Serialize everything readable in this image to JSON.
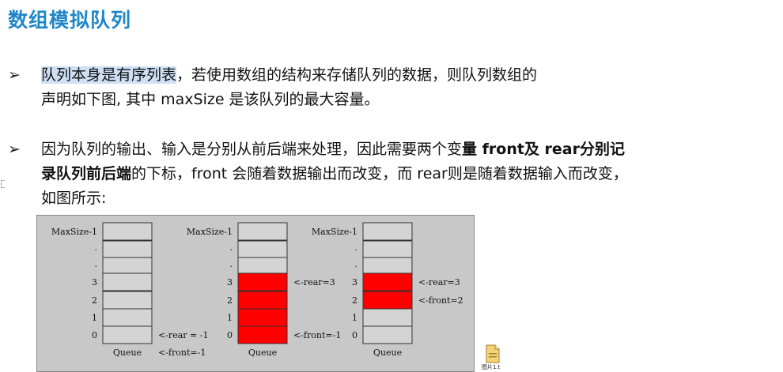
{
  "title": "数组模拟队列",
  "bullet_symbol": "➢",
  "bullets": [
    {
      "highlight": "队列本身是有序列表",
      "text_a": "，若使用数组的结构来存储队列的数据，则队列数组的",
      "text_b": "声明如下图, 其中 maxSize 是该队列的最大容量。"
    },
    {
      "text_a": "因为队列的输出、输入是分别从前后端来处理，因此需要两个变",
      "bold_a": "量 front及 rear分别记",
      "bold_b": "录队列前后端",
      "text_b": "的下标，front 会随着数据输出而改变，而 rear则是随着数据输入而改变，",
      "text_c": "如图所示:"
    }
  ],
  "figure": {
    "queue_label": "Queue",
    "top_label": "MaxSize-1",
    "index_labels": [
      "3",
      "2",
      "1",
      "0"
    ],
    "dots": [
      "·",
      "·"
    ],
    "filled_color": "#ff0000",
    "empty_color": "#d4d4d4",
    "queues": [
      {
        "name": "queue-1",
        "filled_indices": [],
        "pointers": [
          {
            "text": "<-rear = -1",
            "row": "0"
          },
          {
            "text": "<-front=-1",
            "row": "below"
          }
        ]
      },
      {
        "name": "queue-2",
        "filled_indices": [
          0,
          1,
          2,
          3
        ],
        "pointers": [
          {
            "text": "<-rear=3",
            "row": "3"
          },
          {
            "text": "<-front=-1",
            "row": "0"
          }
        ]
      },
      {
        "name": "queue-3",
        "filled_indices": [
          2,
          3
        ],
        "pointers": [
          {
            "text": "<-rear=3",
            "row": "3"
          },
          {
            "text": "<-front=2",
            "row": "2"
          }
        ]
      }
    ]
  },
  "file_icon": {
    "name": "document-icon",
    "label": "图片1.t"
  }
}
